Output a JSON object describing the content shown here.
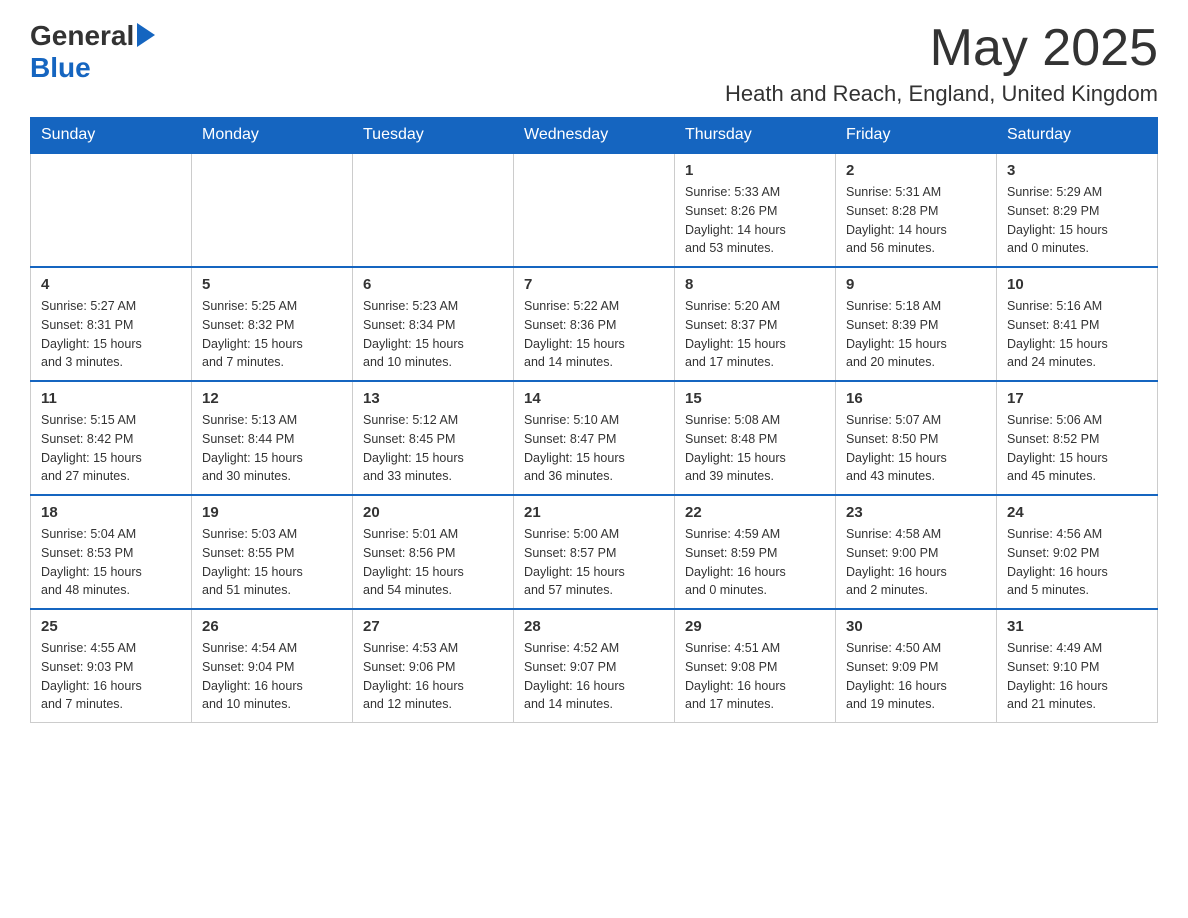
{
  "header": {
    "logo_general": "General",
    "logo_blue": "Blue",
    "month_year": "May 2025",
    "location": "Heath and Reach, England, United Kingdom"
  },
  "days_of_week": [
    "Sunday",
    "Monday",
    "Tuesday",
    "Wednesday",
    "Thursday",
    "Friday",
    "Saturday"
  ],
  "weeks": [
    [
      {
        "day": "",
        "info": ""
      },
      {
        "day": "",
        "info": ""
      },
      {
        "day": "",
        "info": ""
      },
      {
        "day": "",
        "info": ""
      },
      {
        "day": "1",
        "info": "Sunrise: 5:33 AM\nSunset: 8:26 PM\nDaylight: 14 hours\nand 53 minutes."
      },
      {
        "day": "2",
        "info": "Sunrise: 5:31 AM\nSunset: 8:28 PM\nDaylight: 14 hours\nand 56 minutes."
      },
      {
        "day": "3",
        "info": "Sunrise: 5:29 AM\nSunset: 8:29 PM\nDaylight: 15 hours\nand 0 minutes."
      }
    ],
    [
      {
        "day": "4",
        "info": "Sunrise: 5:27 AM\nSunset: 8:31 PM\nDaylight: 15 hours\nand 3 minutes."
      },
      {
        "day": "5",
        "info": "Sunrise: 5:25 AM\nSunset: 8:32 PM\nDaylight: 15 hours\nand 7 minutes."
      },
      {
        "day": "6",
        "info": "Sunrise: 5:23 AM\nSunset: 8:34 PM\nDaylight: 15 hours\nand 10 minutes."
      },
      {
        "day": "7",
        "info": "Sunrise: 5:22 AM\nSunset: 8:36 PM\nDaylight: 15 hours\nand 14 minutes."
      },
      {
        "day": "8",
        "info": "Sunrise: 5:20 AM\nSunset: 8:37 PM\nDaylight: 15 hours\nand 17 minutes."
      },
      {
        "day": "9",
        "info": "Sunrise: 5:18 AM\nSunset: 8:39 PM\nDaylight: 15 hours\nand 20 minutes."
      },
      {
        "day": "10",
        "info": "Sunrise: 5:16 AM\nSunset: 8:41 PM\nDaylight: 15 hours\nand 24 minutes."
      }
    ],
    [
      {
        "day": "11",
        "info": "Sunrise: 5:15 AM\nSunset: 8:42 PM\nDaylight: 15 hours\nand 27 minutes."
      },
      {
        "day": "12",
        "info": "Sunrise: 5:13 AM\nSunset: 8:44 PM\nDaylight: 15 hours\nand 30 minutes."
      },
      {
        "day": "13",
        "info": "Sunrise: 5:12 AM\nSunset: 8:45 PM\nDaylight: 15 hours\nand 33 minutes."
      },
      {
        "day": "14",
        "info": "Sunrise: 5:10 AM\nSunset: 8:47 PM\nDaylight: 15 hours\nand 36 minutes."
      },
      {
        "day": "15",
        "info": "Sunrise: 5:08 AM\nSunset: 8:48 PM\nDaylight: 15 hours\nand 39 minutes."
      },
      {
        "day": "16",
        "info": "Sunrise: 5:07 AM\nSunset: 8:50 PM\nDaylight: 15 hours\nand 43 minutes."
      },
      {
        "day": "17",
        "info": "Sunrise: 5:06 AM\nSunset: 8:52 PM\nDaylight: 15 hours\nand 45 minutes."
      }
    ],
    [
      {
        "day": "18",
        "info": "Sunrise: 5:04 AM\nSunset: 8:53 PM\nDaylight: 15 hours\nand 48 minutes."
      },
      {
        "day": "19",
        "info": "Sunrise: 5:03 AM\nSunset: 8:55 PM\nDaylight: 15 hours\nand 51 minutes."
      },
      {
        "day": "20",
        "info": "Sunrise: 5:01 AM\nSunset: 8:56 PM\nDaylight: 15 hours\nand 54 minutes."
      },
      {
        "day": "21",
        "info": "Sunrise: 5:00 AM\nSunset: 8:57 PM\nDaylight: 15 hours\nand 57 minutes."
      },
      {
        "day": "22",
        "info": "Sunrise: 4:59 AM\nSunset: 8:59 PM\nDaylight: 16 hours\nand 0 minutes."
      },
      {
        "day": "23",
        "info": "Sunrise: 4:58 AM\nSunset: 9:00 PM\nDaylight: 16 hours\nand 2 minutes."
      },
      {
        "day": "24",
        "info": "Sunrise: 4:56 AM\nSunset: 9:02 PM\nDaylight: 16 hours\nand 5 minutes."
      }
    ],
    [
      {
        "day": "25",
        "info": "Sunrise: 4:55 AM\nSunset: 9:03 PM\nDaylight: 16 hours\nand 7 minutes."
      },
      {
        "day": "26",
        "info": "Sunrise: 4:54 AM\nSunset: 9:04 PM\nDaylight: 16 hours\nand 10 minutes."
      },
      {
        "day": "27",
        "info": "Sunrise: 4:53 AM\nSunset: 9:06 PM\nDaylight: 16 hours\nand 12 minutes."
      },
      {
        "day": "28",
        "info": "Sunrise: 4:52 AM\nSunset: 9:07 PM\nDaylight: 16 hours\nand 14 minutes."
      },
      {
        "day": "29",
        "info": "Sunrise: 4:51 AM\nSunset: 9:08 PM\nDaylight: 16 hours\nand 17 minutes."
      },
      {
        "day": "30",
        "info": "Sunrise: 4:50 AM\nSunset: 9:09 PM\nDaylight: 16 hours\nand 19 minutes."
      },
      {
        "day": "31",
        "info": "Sunrise: 4:49 AM\nSunset: 9:10 PM\nDaylight: 16 hours\nand 21 minutes."
      }
    ]
  ]
}
